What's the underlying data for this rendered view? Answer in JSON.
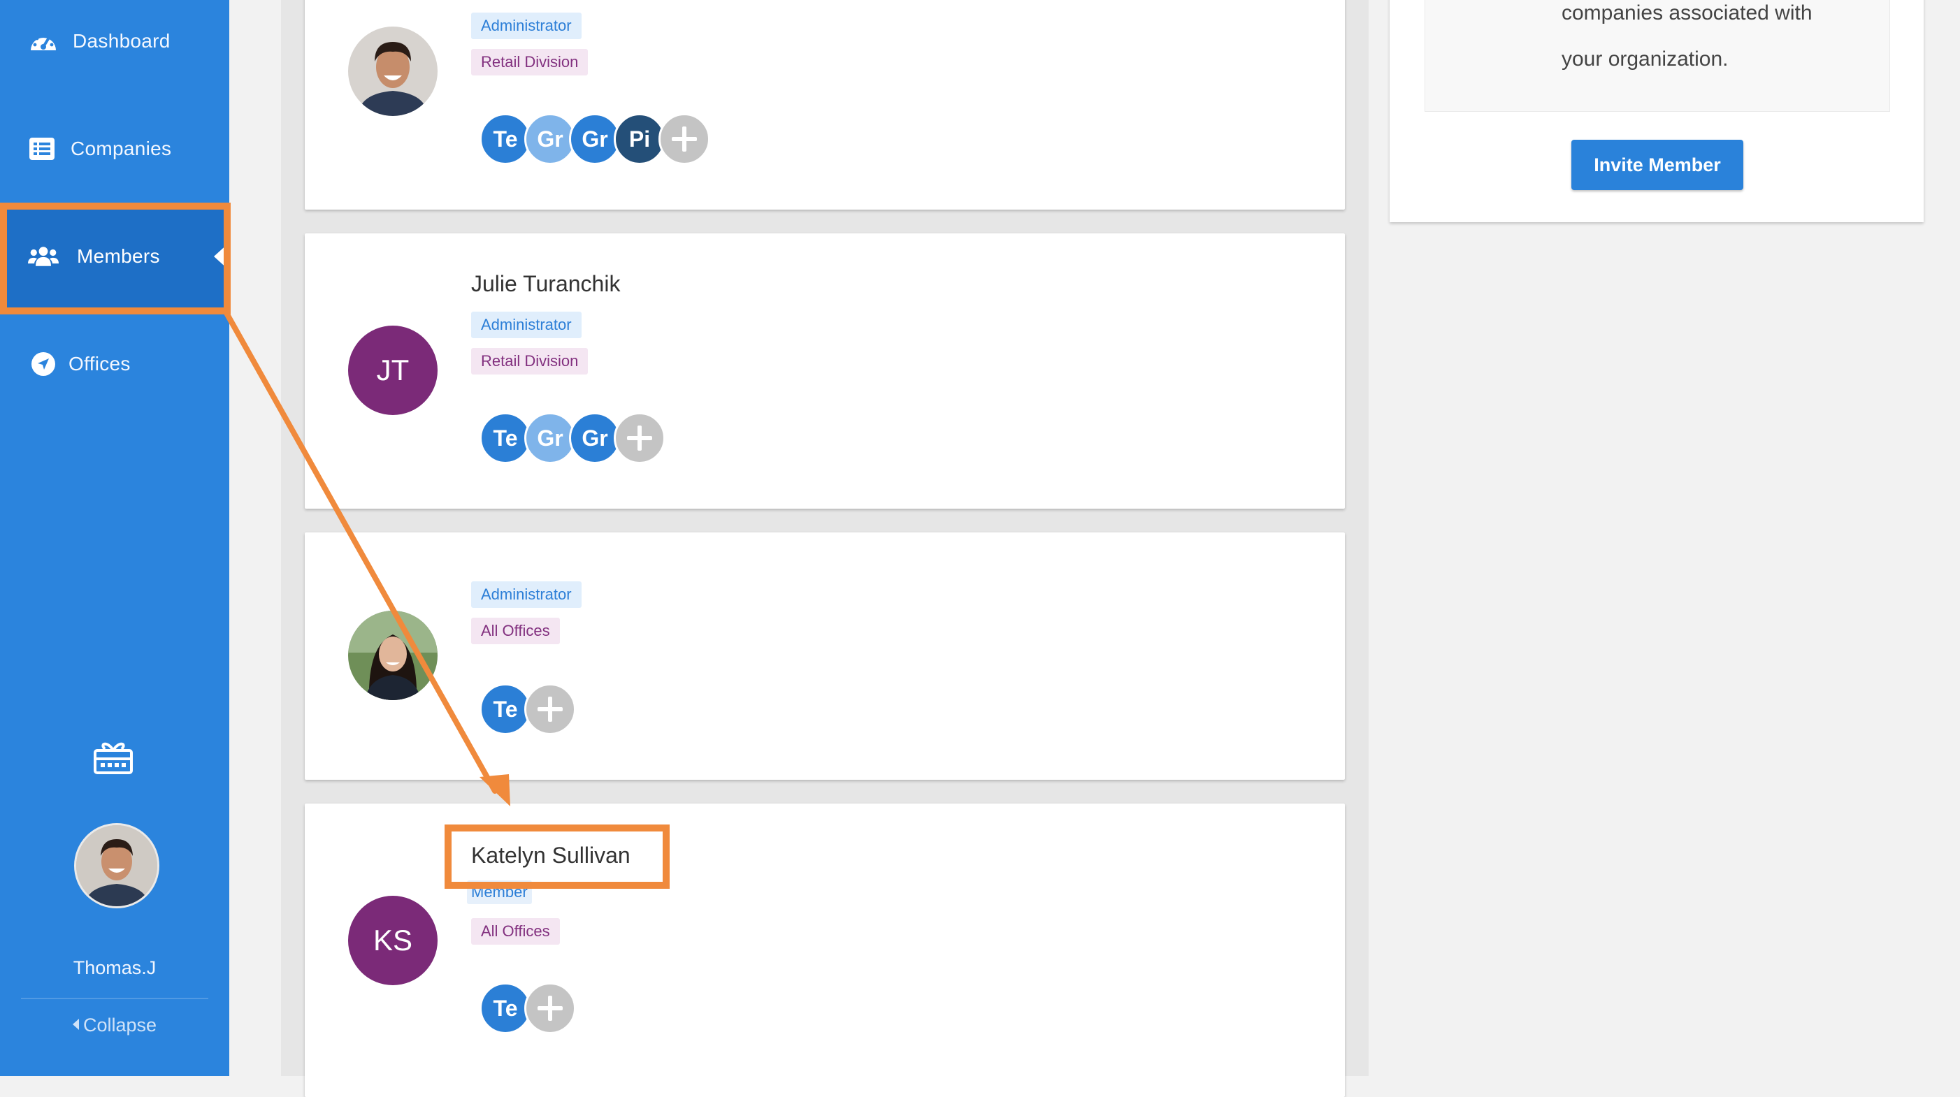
{
  "sidebar": {
    "items": [
      {
        "label": "Dashboard",
        "icon": "dashboard-gauge-icon"
      },
      {
        "label": "Companies",
        "icon": "list-icon"
      },
      {
        "label": "Members",
        "icon": "users-icon",
        "active": true
      },
      {
        "label": "Offices",
        "icon": "location-arrow-icon"
      }
    ],
    "gift_icon": "gift-icon",
    "user_name": "Thomas.J",
    "collapse_label": "Collapse"
  },
  "members": [
    {
      "name": "",
      "avatar": "photo",
      "role": "Administrator",
      "division": "Retail Division",
      "companies": [
        "Te",
        "Gr",
        "Gr",
        "Pi"
      ]
    },
    {
      "name": "Julie Turanchik",
      "avatar": "initials",
      "initials": "JT",
      "role": "Administrator",
      "division": "Retail Division",
      "companies": [
        "Te",
        "Gr",
        "Gr"
      ]
    },
    {
      "name": "",
      "avatar": "photo",
      "role": "Administrator",
      "division": "All Offices",
      "companies": [
        "Te"
      ]
    },
    {
      "name": "Katelyn Sullivan",
      "avatar": "initials",
      "initials": "KS",
      "role": "Member",
      "division": "All Offices",
      "companies": [
        "Te"
      ]
    }
  ],
  "info_panel": {
    "text_line1": "companies associated with",
    "text_line2": "your organization.",
    "invite_label": "Invite Member"
  },
  "colors": {
    "sidebar": "#2b84dd",
    "sidebar_active": "#1e6fc6",
    "avatar_purple": "#7b2a78",
    "annotation_orange": "#f08a3c",
    "button_blue": "#2a82da"
  }
}
